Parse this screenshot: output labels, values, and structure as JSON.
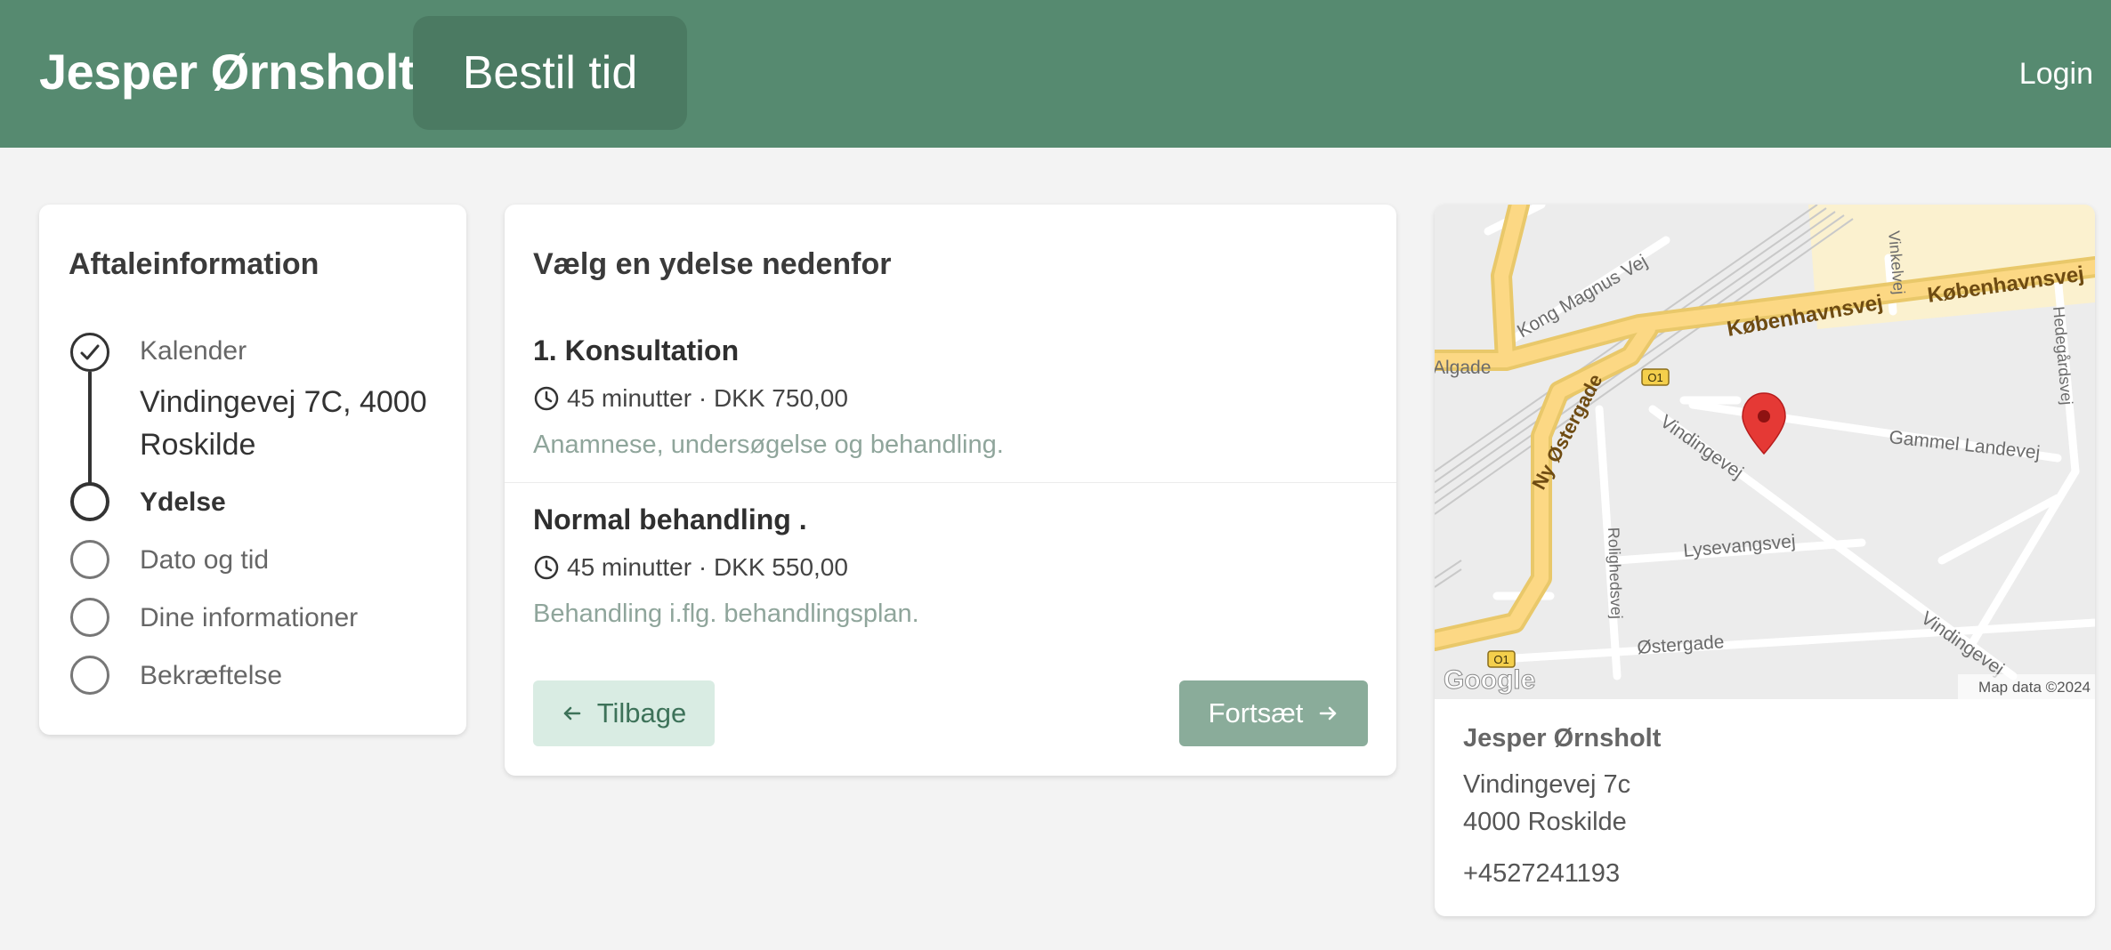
{
  "header": {
    "brand": "Jesper Ørnsholt",
    "book_button": "Bestil tid",
    "login": "Login",
    "color": "#568a70"
  },
  "steps": {
    "title": "Aftaleinformation",
    "items": [
      {
        "label": "Kalender",
        "state": "done",
        "detail": "Vindingevej 7C, 4000 Roskilde"
      },
      {
        "label": "Ydelse",
        "state": "active"
      },
      {
        "label": "Dato og tid",
        "state": "pending"
      },
      {
        "label": "Dine informationer",
        "state": "pending"
      },
      {
        "label": "Bekræftelse",
        "state": "pending"
      }
    ]
  },
  "services": {
    "title": "Vælg en ydelse nedenfor",
    "items": [
      {
        "name": "1. Konsultation",
        "meta": "45 minutter · DKK 750,00",
        "description": "Anamnese, undersøgelse og behandling."
      },
      {
        "name": "Normal behandling .",
        "meta": "45 minutter · DKK 550,00",
        "description": "Behandling i.flg. behandlingsplan."
      }
    ],
    "back_label": "Tilbage",
    "next_label": "Fortsæt"
  },
  "location": {
    "map": {
      "streets": [
        "Københavnsvej",
        "Københavnsvej",
        "Kong Magnus Vej",
        "Vinkelvej",
        "Hedegårdsvej",
        "Algade",
        "Ny Østergade",
        "Vindingevej",
        "Gammel Landevej",
        "Rolighedsvej",
        "Lysevangsvej",
        "Østergade",
        "Vindingevej"
      ],
      "route_badges": [
        "O1",
        "O1"
      ],
      "logo": "Google",
      "attribution": "Map data ©2024"
    },
    "name": "Jesper Ørnsholt",
    "street": "Vindingevej 7c",
    "city": "4000 Roskilde",
    "phone": "+4527241193"
  }
}
